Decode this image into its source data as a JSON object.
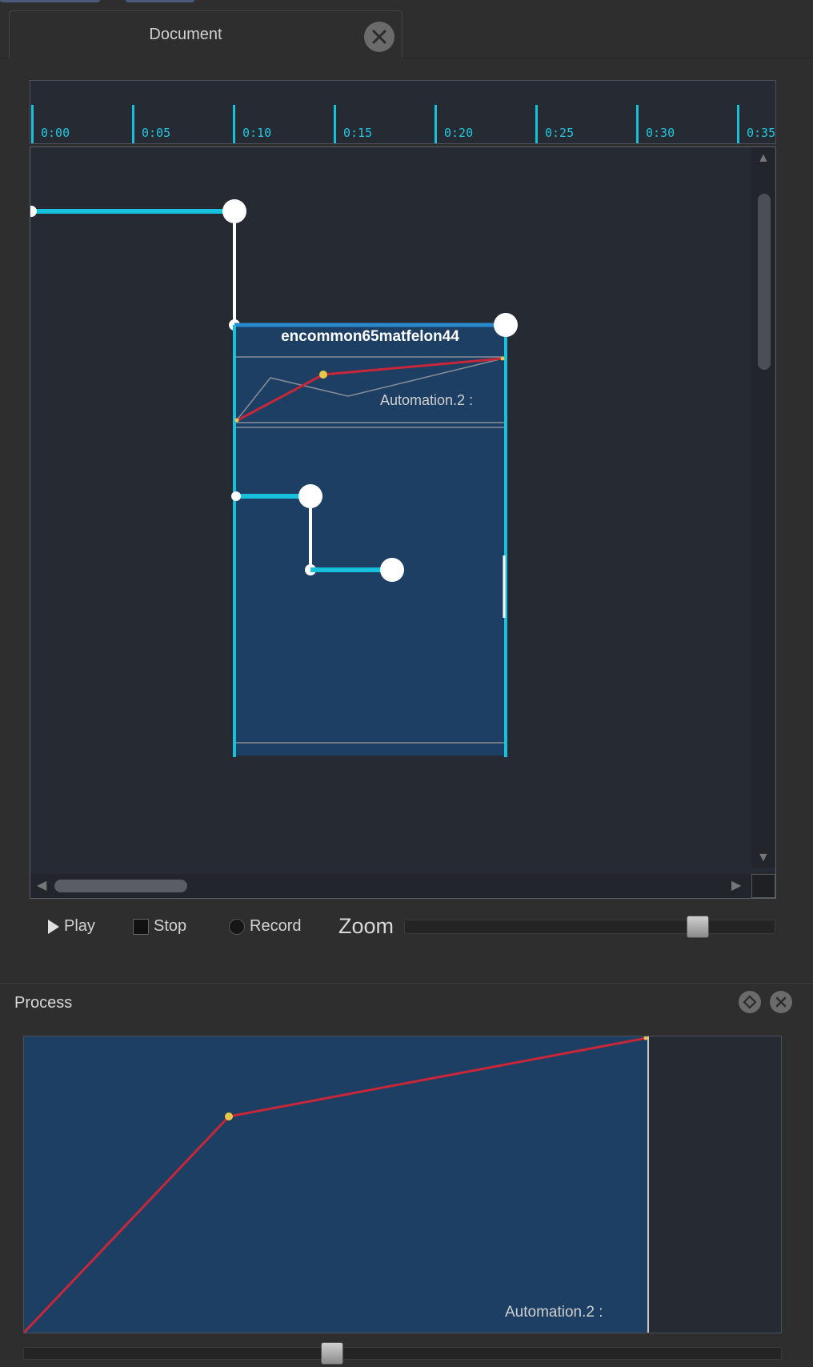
{
  "document_tab": {
    "title": "Document"
  },
  "timeline": {
    "ticks": [
      "0:00",
      "0:05",
      "0:10",
      "0:15",
      "0:20",
      "0:25",
      "0:30",
      "0:35"
    ]
  },
  "scenario": {
    "box_title": "encommon65matfelon44",
    "automation_label": "Automation.2 :"
  },
  "transport": {
    "play_label": "Play",
    "stop_label": "Stop",
    "record_label": "Record",
    "zoom_label": "Zoom"
  },
  "process": {
    "title": "Process",
    "automation_label": "Automation.2 :"
  },
  "colors": {
    "accent_cyan": "#19c0dc",
    "box_fill": "#1c3f63",
    "curve_red": "#c8273a",
    "point_yellow": "#e8c84a",
    "background": "#2e2e2e",
    "canvas": "#262a32"
  }
}
